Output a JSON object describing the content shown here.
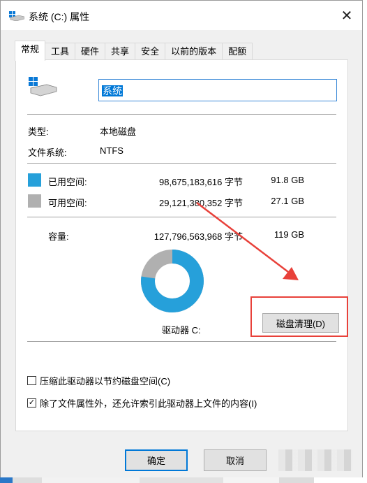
{
  "window": {
    "title": "系统 (C:) 属性",
    "close_glyph": "✕"
  },
  "tabs": [
    {
      "label": "常规",
      "active": true
    },
    {
      "label": "工具"
    },
    {
      "label": "硬件"
    },
    {
      "label": "共享"
    },
    {
      "label": "安全"
    },
    {
      "label": "以前的版本"
    },
    {
      "label": "配额"
    }
  ],
  "general": {
    "name_value": "系统",
    "type_label": "类型:",
    "type_value": "本地磁盘",
    "fs_label": "文件系统:",
    "fs_value": "NTFS",
    "used": {
      "label": "已用空间:",
      "bytes": "98,675,183,616 字节",
      "size": "91.8 GB",
      "color": "#26a0da"
    },
    "free": {
      "label": "可用空间:",
      "bytes": "29,121,380,352 字节",
      "size": "27.1 GB",
      "color": "#b0b0b0"
    },
    "capacity": {
      "label": "容量:",
      "bytes": "127,796,563,968 字节",
      "size": "119 GB"
    },
    "used_fraction": 0.772,
    "drive_label": "驱动器 C:",
    "cleanup_button": "磁盘清理(D)"
  },
  "options": {
    "compress": {
      "label": "压缩此驱动器以节约磁盘空间(C)",
      "checked": false
    },
    "index": {
      "label": "除了文件属性外，还允许索引此驱动器上文件的内容(I)",
      "checked": true,
      "check_glyph": "✓"
    }
  },
  "buttons": {
    "ok": "确定",
    "cancel": "取消"
  },
  "icons": {
    "drive": "drive-icon",
    "close": "close-icon"
  },
  "annotation": {
    "color": "#e8413a"
  }
}
